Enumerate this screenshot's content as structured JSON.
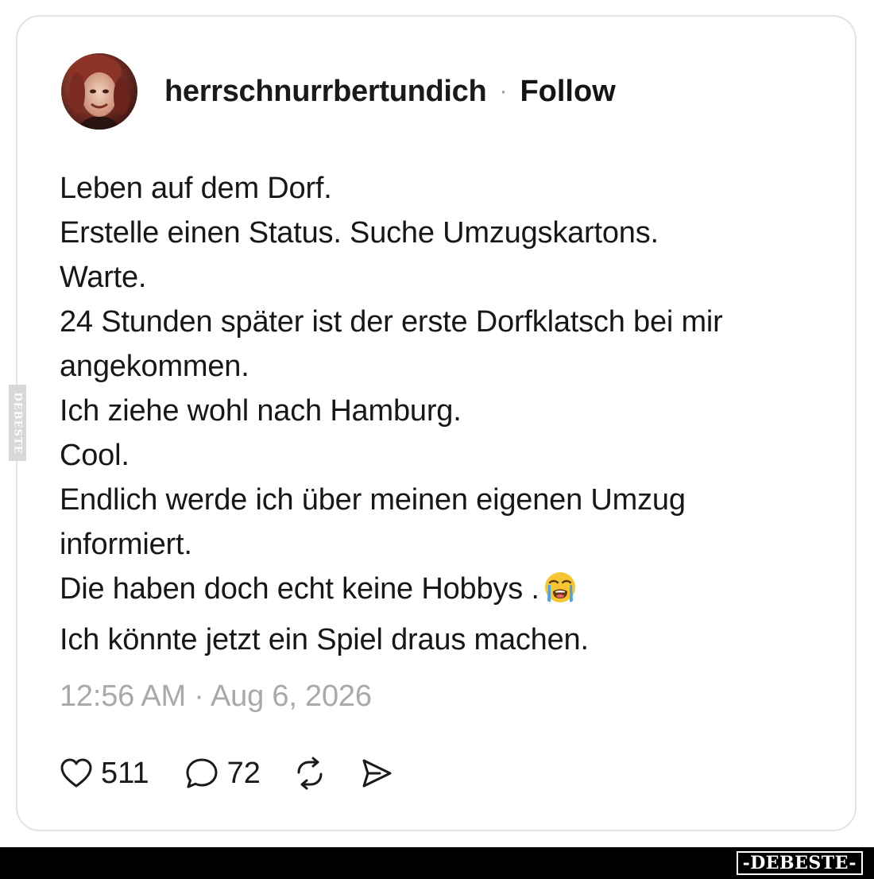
{
  "post": {
    "username": "herrschnurrbertundich",
    "separator": "·",
    "follow_label": "Follow",
    "avatar_icon": "profile-photo",
    "lines": [
      "Leben auf dem Dorf.",
      "Erstelle einen Status. Suche Umzugskartons.",
      "Warte.",
      "24 Stunden später ist der erste Dorfklatsch bei mir",
      "angekommen.",
      "Ich ziehe wohl nach Hamburg.",
      "Cool.",
      "Endlich werde ich über meinen eigenen Umzug",
      "informiert.",
      "Die haben doch echt keine Hobbys .",
      "Ich könnte jetzt ein Spiel draus machen."
    ],
    "emoji": "loudly-crying-face",
    "timestamp": "12:56 AM · Aug 6, 2026"
  },
  "actions": {
    "likes": "511",
    "comments": "72",
    "like_icon": "heart-icon",
    "comment_icon": "speech-bubble-icon",
    "repost_icon": "repost-icon",
    "share_icon": "send-icon"
  },
  "watermark": {
    "side_text": "DEBESTE",
    "footer_text": "-DEBESTE-"
  },
  "colors": {
    "text": "#171717",
    "muted": "#a9a9a9",
    "card_border": "#e3e3e3",
    "footer_bg": "#000000"
  }
}
